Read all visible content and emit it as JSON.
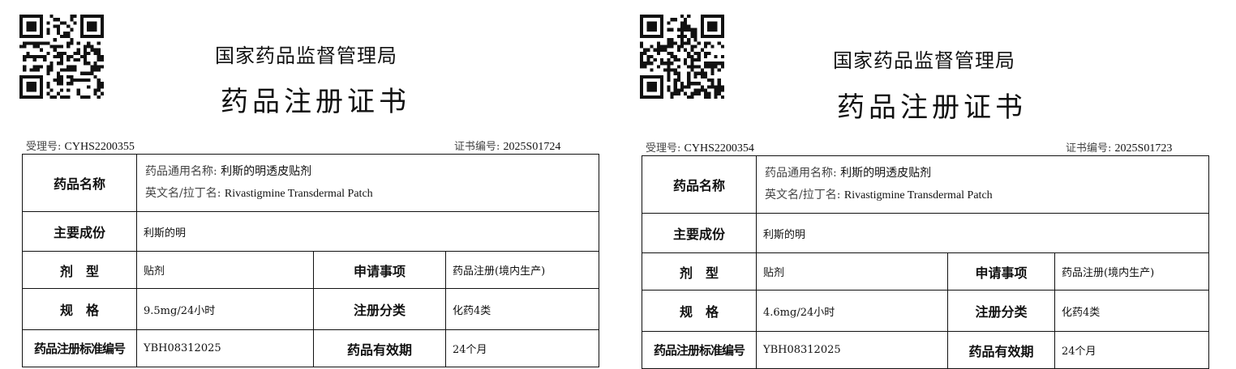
{
  "certificates": [
    {
      "agency": "国家药品监督管理局",
      "doc_title": "药品注册证书",
      "acceptance_label": "受理号:",
      "acceptance_no": "CYHS2200355",
      "cert_no_label": "证书编号:",
      "cert_no": "2025S01724",
      "drug_name_label": "药品名称",
      "generic_name_label": "药品通用名称:",
      "generic_name": "利斯的明透皮贴剂",
      "english_name_label": "英文名/拉丁名:",
      "english_name": "Rivastigmine Transdermal Patch",
      "ingredient_label": "主要成份",
      "ingredient": "利斯的明",
      "form_label": "剂　型",
      "form": "贴剂",
      "application_label": "申请事项",
      "application": "药品注册(境内生产)",
      "spec_label": "规　格",
      "spec": "9.5mg/24小时",
      "category_label": "注册分类",
      "category": "化药4类",
      "standard_label": "药品注册标准编号",
      "standard_no": "YBH08312025",
      "validity_label": "药品有效期",
      "validity": "24个月"
    },
    {
      "agency": "国家药品监督管理局",
      "doc_title": "药品注册证书",
      "acceptance_label": "受理号:",
      "acceptance_no": "CYHS2200354",
      "cert_no_label": "证书编号:",
      "cert_no": "2025S01723",
      "drug_name_label": "药品名称",
      "generic_name_label": "药品通用名称:",
      "generic_name": "利斯的明透皮贴剂",
      "english_name_label": "英文名/拉丁名:",
      "english_name": "Rivastigmine Transdermal Patch",
      "ingredient_label": "主要成份",
      "ingredient": "利斯的明",
      "form_label": "剂　型",
      "form": "贴剂",
      "application_label": "申请事项",
      "application": "药品注册(境内生产)",
      "spec_label": "规　格",
      "spec": "4.6mg/24小时",
      "category_label": "注册分类",
      "category": "化药4类",
      "standard_label": "药品注册标准编号",
      "standard_no": "YBH08312025",
      "validity_label": "药品有效期",
      "validity": "24个月"
    }
  ]
}
